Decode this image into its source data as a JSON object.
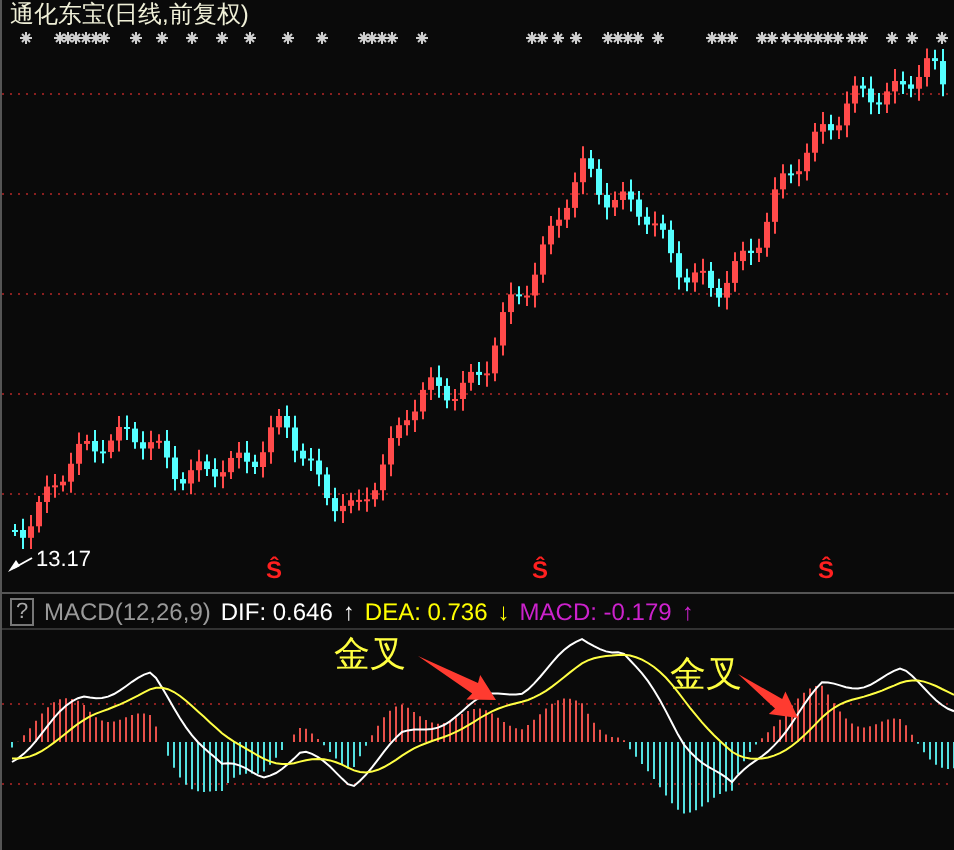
{
  "title": "通化东宝(日线,前复权)",
  "price_chart": {
    "low_label": "13.17",
    "signals": [
      "Ŝ",
      "Ŝ",
      "Ŝ"
    ]
  },
  "indicator": {
    "help": "?",
    "name": "MACD(12,26,9)",
    "values": [
      {
        "label": "DIF: 0.646",
        "arrow": "↑",
        "color": "#ffffff"
      },
      {
        "label": "DEA: 0.736",
        "arrow": "↓",
        "color": "#ffff00"
      },
      {
        "label": "MACD: -0.179",
        "arrow": "↑",
        "color": "#cc22cc"
      }
    ]
  },
  "annotations": [
    "金叉",
    "金叉"
  ]
}
